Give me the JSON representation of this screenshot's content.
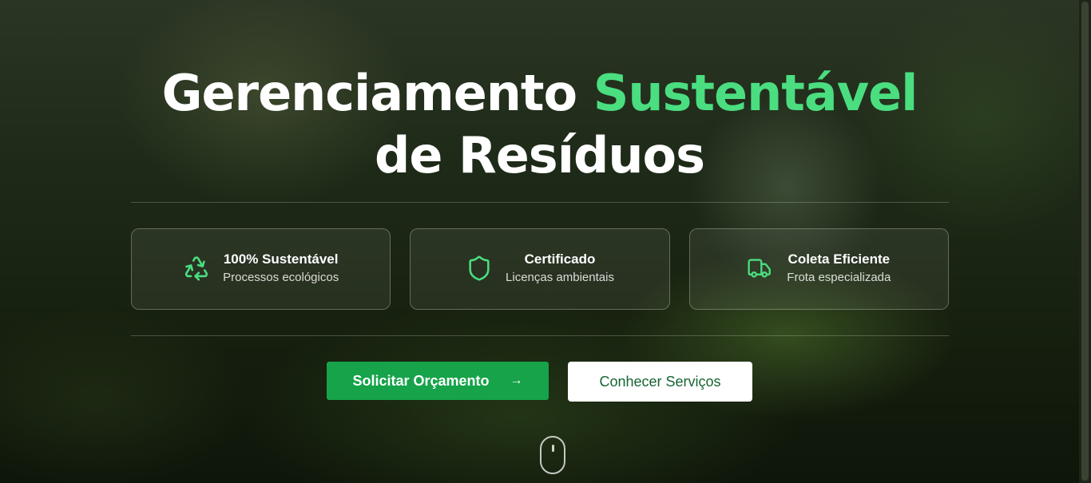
{
  "hero": {
    "title_part1": "Gerenciamento ",
    "title_accent": "Sustentável",
    "title_part2": "de Resíduos"
  },
  "features": [
    {
      "title": "100% Sustentável",
      "subtitle": "Processos ecológicos",
      "icon": "recycle-icon"
    },
    {
      "title": "Certificado",
      "subtitle": "Licenças ambientais",
      "icon": "shield-icon"
    },
    {
      "title": "Coleta Eficiente",
      "subtitle": "Frota especializada",
      "icon": "truck-icon"
    }
  ],
  "actions": {
    "primary_label": "Solicitar Orçamento",
    "primary_arrow": "→",
    "secondary_label": "Conhecer Serviços"
  },
  "colors": {
    "accent": "#4ade80",
    "primary_button": "#16a34a",
    "secondary_button_text": "#166534"
  }
}
